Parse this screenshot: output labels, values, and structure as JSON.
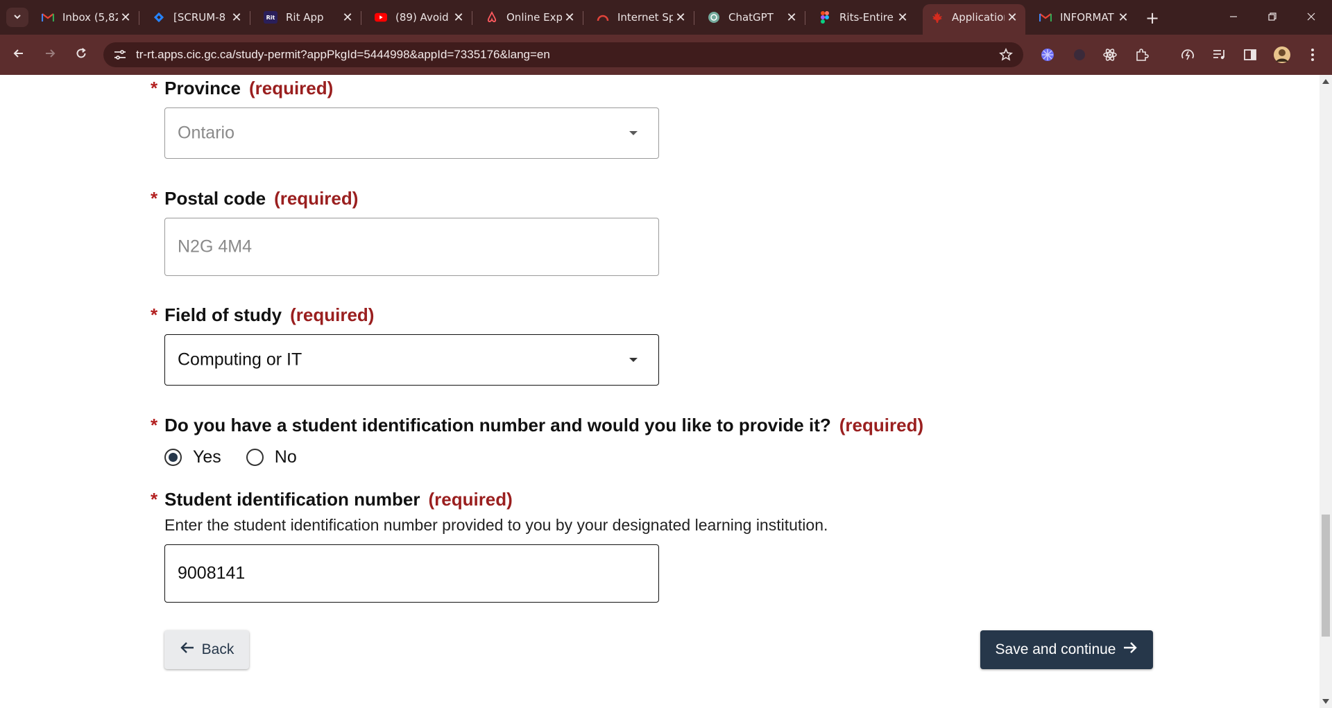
{
  "browser": {
    "tabs": [
      {
        "title": "Inbox (5,82",
        "icon": "gmail-icon"
      },
      {
        "title": "[SCRUM-8",
        "icon": "jira-icon"
      },
      {
        "title": "Rit App",
        "icon": "rit-icon",
        "icon_text": "Rit"
      },
      {
        "title": "(89) Avoid",
        "icon": "youtube-icon"
      },
      {
        "title": "Online Exp",
        "icon": "airbnb-icon"
      },
      {
        "title": "Internet Sp",
        "icon": "speedtest-icon"
      },
      {
        "title": "ChatGPT",
        "icon": "chatgpt-icon"
      },
      {
        "title": "Rits-Entire",
        "icon": "figma-icon"
      },
      {
        "title": "Application",
        "icon": "canada-leaf-icon",
        "active": true
      },
      {
        "title": "INFORMAT",
        "icon": "gmail-icon"
      }
    ],
    "url": "tr-rt.apps.cic.gc.ca/study-permit?appPkgId=5444998&appId=7335176&lang=en",
    "colors": {
      "frame": "#3b1f1f",
      "toolbar": "#5c2d2d",
      "omnibox": "#3f1c1c"
    }
  },
  "form": {
    "required_marker": "*",
    "required_text": "(required)",
    "province": {
      "label": "Province",
      "value": "Ontario",
      "disabled": true
    },
    "postal_code": {
      "label": "Postal code",
      "value": "N2G 4M4",
      "disabled": true
    },
    "field_of_study": {
      "label": "Field of study",
      "value": "Computing or IT"
    },
    "student_id_question": {
      "label": "Do you have a student identification number and would you like to provide it?",
      "options": [
        "Yes",
        "No"
      ],
      "selected": "Yes"
    },
    "student_id": {
      "label": "Student identification number",
      "hint": "Enter the student identification number provided to you by your designated learning institution.",
      "value": "9008141"
    },
    "back_label": "Back",
    "save_label": "Save and continue",
    "colors": {
      "required": "#9a1f1f",
      "primary_button": "#26374a",
      "secondary_button": "#eaebed"
    }
  }
}
